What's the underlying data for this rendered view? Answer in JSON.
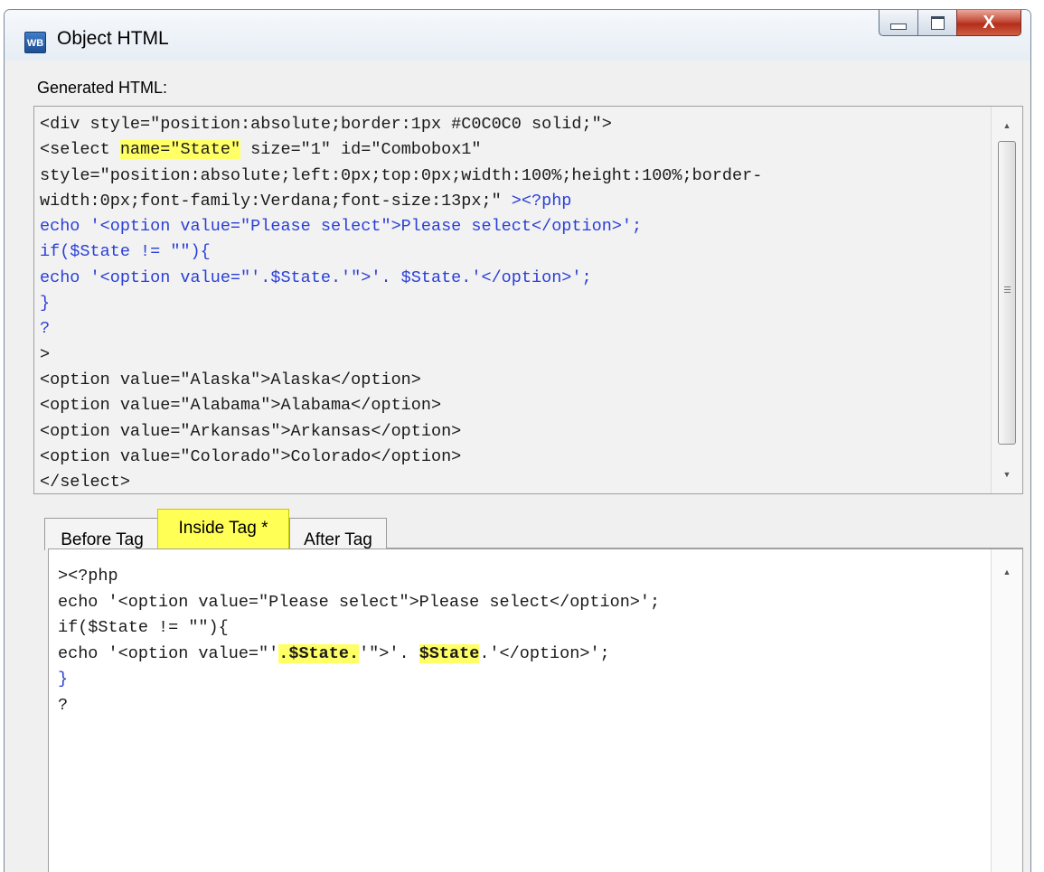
{
  "window": {
    "title": "Object HTML",
    "icon": "WB",
    "buttons": {
      "minimize": "minimize-icon",
      "maximize": "maximize-icon",
      "close": "X"
    }
  },
  "generated": {
    "label": "Generated HTML:",
    "lines": [
      "<div style=\"position:absolute;border:1px #C0C0C0 solid;\">",
      "<select ",
      "name=\"State\"",
      " size=\"1\" id=\"Combobox1\"",
      "style=\"position:absolute;left:0px;top:0px;width:100%;height:100%;border-",
      "width:0px;font-family:Verdana;font-size:13px;\" ",
      "><?php",
      "echo '<option value=\"Please select\">Please select</option>';",
      "if($State != \"\"){",
      "echo '<option value=\"'.$State.'\">'. $State.'</option>';",
      "}",
      "?",
      ">",
      "<option value=\"Alaska\">Alaska</option>",
      "<option value=\"Alabama\">Alabama</option>",
      "<option value=\"Arkansas\">Arkansas</option>",
      "<option value=\"Colorado\">Colorado</option>",
      "</select>"
    ]
  },
  "tabs": [
    {
      "label": "Before Tag"
    },
    {
      "label": "Inside Tag *"
    },
    {
      "label": "After Tag"
    }
  ],
  "inside": {
    "lines": [
      "><?php",
      "echo '<option value=\"Please select\">Please select</option>';",
      "if($State != \"\"){",
      "echo '<option value=\"'",
      ".$State.",
      "'\">'. ",
      "$State",
      ".'</option>';",
      "}",
      "?"
    ]
  },
  "colors": {
    "highlight": "#ffff66",
    "php_code": "#2a3fd6",
    "close_button": "#c44c37"
  }
}
